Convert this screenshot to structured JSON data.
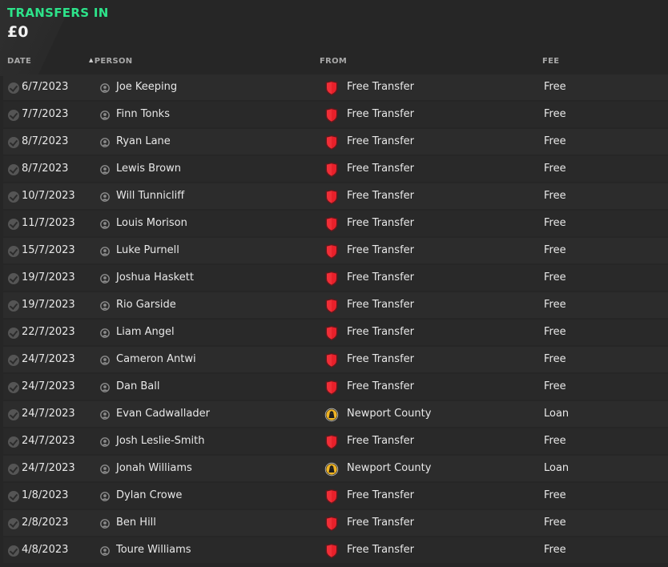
{
  "header": {
    "title": "TRANSFERS IN",
    "total": "£0"
  },
  "columns": {
    "date": "DATE",
    "person": "PERSON",
    "from": "FROM",
    "fee": "FEE"
  },
  "sort": {
    "column": "person",
    "direction": "ascending"
  },
  "colors": {
    "title": "#2de38a",
    "background": "#262626",
    "row": "#2c2c2c",
    "free_transfer_badge": "#e8202a"
  },
  "rows": [
    {
      "date": "6/7/2023",
      "person": "Joe Keeping",
      "from": "Free Transfer",
      "from_icon": "free-transfer-shield-icon",
      "fee": "Free"
    },
    {
      "date": "7/7/2023",
      "person": "Finn Tonks",
      "from": "Free Transfer",
      "from_icon": "free-transfer-shield-icon",
      "fee": "Free"
    },
    {
      "date": "8/7/2023",
      "person": "Ryan Lane",
      "from": "Free Transfer",
      "from_icon": "free-transfer-shield-icon",
      "fee": "Free"
    },
    {
      "date": "8/7/2023",
      "person": "Lewis Brown",
      "from": "Free Transfer",
      "from_icon": "free-transfer-shield-icon",
      "fee": "Free"
    },
    {
      "date": "10/7/2023",
      "person": "Will Tunnicliff",
      "from": "Free Transfer",
      "from_icon": "free-transfer-shield-icon",
      "fee": "Free"
    },
    {
      "date": "11/7/2023",
      "person": "Louis Morison",
      "from": "Free Transfer",
      "from_icon": "free-transfer-shield-icon",
      "fee": "Free"
    },
    {
      "date": "15/7/2023",
      "person": "Luke Purnell",
      "from": "Free Transfer",
      "from_icon": "free-transfer-shield-icon",
      "fee": "Free"
    },
    {
      "date": "19/7/2023",
      "person": "Joshua Haskett",
      "from": "Free Transfer",
      "from_icon": "free-transfer-shield-icon",
      "fee": "Free"
    },
    {
      "date": "19/7/2023",
      "person": "Rio Garside",
      "from": "Free Transfer",
      "from_icon": "free-transfer-shield-icon",
      "fee": "Free"
    },
    {
      "date": "22/7/2023",
      "person": "Liam Angel",
      "from": "Free Transfer",
      "from_icon": "free-transfer-shield-icon",
      "fee": "Free"
    },
    {
      "date": "24/7/2023",
      "person": "Cameron Antwi",
      "from": "Free Transfer",
      "from_icon": "free-transfer-shield-icon",
      "fee": "Free"
    },
    {
      "date": "24/7/2023",
      "person": "Dan Ball",
      "from": "Free Transfer",
      "from_icon": "free-transfer-shield-icon",
      "fee": "Free"
    },
    {
      "date": "24/7/2023",
      "person": "Evan Cadwallader",
      "from": "Newport County",
      "from_icon": "newport-county-crest-icon",
      "fee": "Loan"
    },
    {
      "date": "24/7/2023",
      "person": "Josh Leslie-Smith",
      "from": "Free Transfer",
      "from_icon": "free-transfer-shield-icon",
      "fee": "Free"
    },
    {
      "date": "24/7/2023",
      "person": "Jonah Williams",
      "from": "Newport County",
      "from_icon": "newport-county-crest-icon",
      "fee": "Loan"
    },
    {
      "date": "1/8/2023",
      "person": "Dylan Crowe",
      "from": "Free Transfer",
      "from_icon": "free-transfer-shield-icon",
      "fee": "Free"
    },
    {
      "date": "2/8/2023",
      "person": "Ben Hill",
      "from": "Free Transfer",
      "from_icon": "free-transfer-shield-icon",
      "fee": "Free"
    },
    {
      "date": "4/8/2023",
      "person": "Toure Williams",
      "from": "Free Transfer",
      "from_icon": "free-transfer-shield-icon",
      "fee": "Free"
    }
  ]
}
